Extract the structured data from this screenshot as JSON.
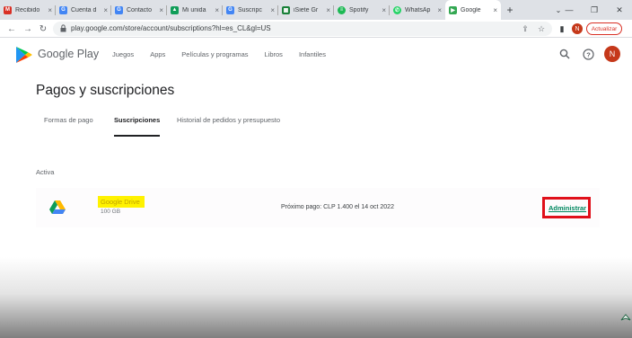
{
  "browser": {
    "tabs": [
      {
        "label": "Recibido",
        "icon": "gmail-icon",
        "color": "#d93025",
        "glyph": "M"
      },
      {
        "label": "Cuenta d",
        "icon": "google-icon",
        "color": "#4285f4",
        "glyph": "G"
      },
      {
        "label": "Contacto",
        "icon": "google-icon",
        "color": "#4285f4",
        "glyph": "G"
      },
      {
        "label": "Mi unida",
        "icon": "drive-icon",
        "color": "#0f9d58",
        "glyph": "▲"
      },
      {
        "label": "Suscripc",
        "icon": "google-icon",
        "color": "#4285f4",
        "glyph": "G"
      },
      {
        "label": "iSiete Gr",
        "icon": "calendar-icon",
        "color": "#188038",
        "glyph": "▦"
      },
      {
        "label": "Spotify",
        "icon": "spotify-icon",
        "color": "#1db954",
        "glyph": "≡"
      },
      {
        "label": "WhatsAp",
        "icon": "whatsapp-icon",
        "color": "#25d366",
        "glyph": "✆"
      },
      {
        "label": "Google",
        "icon": "google-play-icon",
        "color": "#34a853",
        "glyph": "▶"
      }
    ],
    "url": "play.google.com/store/account/subscriptions?hl=es_CL&gl=US",
    "profile_initial": "N",
    "update_label": "Actualizar"
  },
  "header": {
    "brand": "Google Play",
    "nav": [
      "Juegos",
      "Apps",
      "Películas y programas",
      "Libros",
      "Infantiles"
    ],
    "avatar_initial": "N"
  },
  "page": {
    "title": "Pagos y suscripciones",
    "tabs": [
      "Formas de pago",
      "Suscripciones",
      "Historial de pedidos y presupuesto"
    ],
    "active_tab": "Suscripciones",
    "section_label": "Activa"
  },
  "subscription": {
    "name": "Google Drive",
    "size": "100 GB",
    "next_payment": "Próximo pago: CLP 1.400 el 14 oct 2022",
    "manage_label": "Administrar"
  },
  "colors": {
    "accent": "#01875f",
    "highlight": "#fff200",
    "box": "#e0101a",
    "avatar": "#c5381a"
  }
}
